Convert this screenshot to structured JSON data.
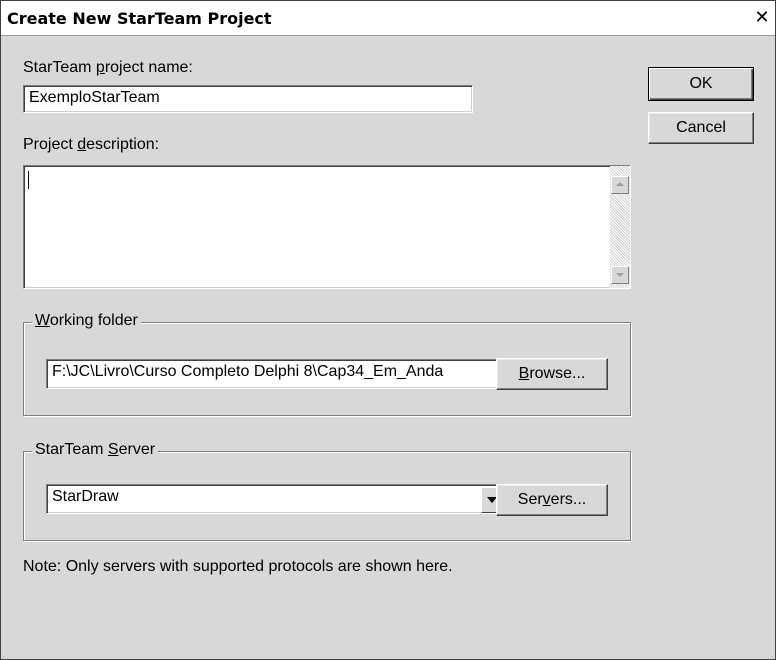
{
  "dialog": {
    "title": "Create New StarTeam Project",
    "close_glyph": "✕"
  },
  "project_name": {
    "label_prefix": "StarTeam ",
    "label_accel": "p",
    "label_suffix": "roject name:",
    "value": "ExemploStarTeam"
  },
  "description": {
    "label_prefix": "Project ",
    "label_accel": "d",
    "label_suffix": "escription:",
    "value": ""
  },
  "working_folder": {
    "legend_prefix": "",
    "legend_accel": "W",
    "legend_suffix": "orking folder",
    "value": "F:\\JC\\Livro\\Curso Completo Delphi 8\\Cap34_Em_Anda",
    "browse_prefix": "",
    "browse_accel": "B",
    "browse_suffix": "rowse..."
  },
  "server": {
    "legend_prefix": "StarTeam ",
    "legend_accel": "S",
    "legend_suffix": "erver",
    "selected": "StarDraw",
    "servers_prefix": "Ser",
    "servers_accel": "v",
    "servers_suffix": "ers..."
  },
  "buttons": {
    "ok": "OK",
    "cancel": "Cancel"
  },
  "note": "Note: Only servers with supported protocols are shown here.",
  "icons": {
    "scroll_up": "scroll-up-arrow-icon",
    "scroll_down": "scroll-down-arrow-icon",
    "dropdown": "chevron-down-icon",
    "close": "close-icon"
  }
}
